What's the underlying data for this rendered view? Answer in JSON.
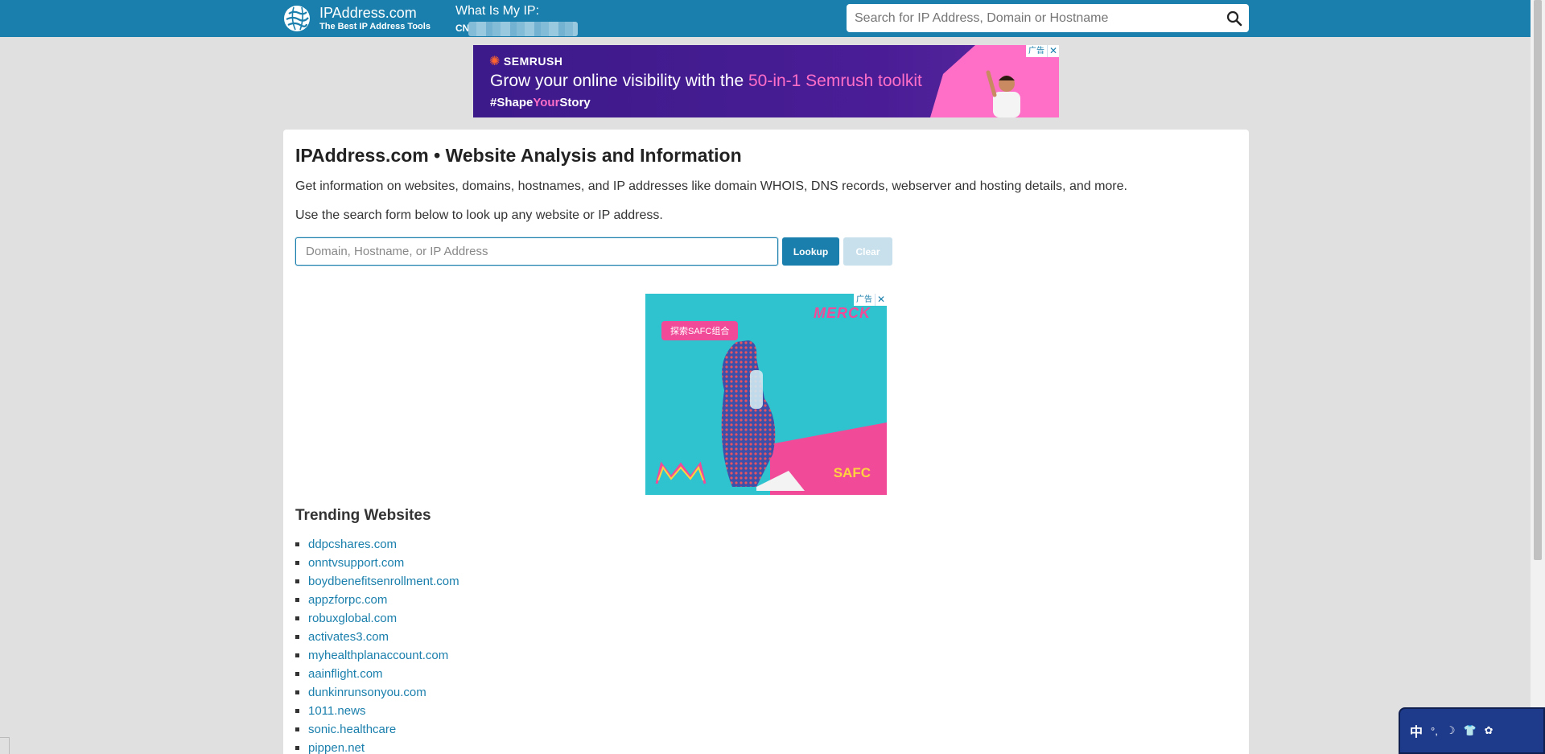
{
  "header": {
    "logo_title": "IPAddress.com",
    "logo_subtitle": "The Best IP Address Tools",
    "myip_label": "What Is My IP:",
    "myip_value_prefix": "CN",
    "search_placeholder": "Search for IP Address, Domain or Hostname"
  },
  "banner_ad": {
    "brand": "SEMRUSH",
    "headline_prefix": "Grow your online visibility with the ",
    "headline_accent": "50-in-1 Semrush toolkit",
    "tag_hash": "#Shape",
    "tag_accent": "Your",
    "tag_end": "Story",
    "choices_label": "广告",
    "close": "✕"
  },
  "main": {
    "title": "IPAddress.com • Website Analysis and Information",
    "intro": "Get information on websites, domains, hostnames, and IP addresses like domain WHOIS, DNS records, webserver and hosting details, and more.",
    "intro2": "Use the search form below to look up any website or IP address.",
    "lookup_placeholder": "Domain, Hostname, or IP Address",
    "lookup_button": "Lookup",
    "clear_button": "Clear"
  },
  "square_ad": {
    "button": "探索SAFC组合",
    "brand": "MERCK",
    "product": "SAFC",
    "choices_label": "广告",
    "close": "✕"
  },
  "trending": {
    "title": "Trending Websites",
    "items": [
      "ddpcshares.com",
      "onntvsupport.com",
      "boydbenefitsenrollment.com",
      "appzforpc.com",
      "robuxglobal.com",
      "activates3.com",
      "myhealthplanaccount.com",
      "aainflight.com",
      "dunkinrunsonyou.com",
      "1011.news",
      "sonic.healthcare",
      "pippen.net"
    ]
  },
  "ime": {
    "mode": "中",
    "icons": [
      "°,",
      "☽",
      "👕",
      "✿"
    ]
  },
  "colors": {
    "header_bg": "#1a7fac",
    "link": "#1a7fac",
    "page_bg": "#e0e0e0"
  }
}
